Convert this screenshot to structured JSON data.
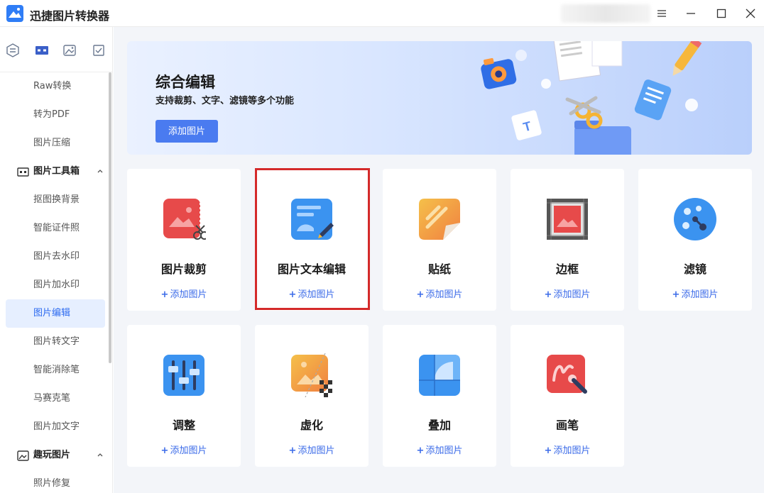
{
  "app": {
    "title": "迅捷图片转换器"
  },
  "sidebar": {
    "items": [
      {
        "label": "Raw转换",
        "type": "item"
      },
      {
        "label": "转为PDF",
        "type": "item"
      },
      {
        "label": "图片压缩",
        "type": "item"
      },
      {
        "label": "图片工具箱",
        "type": "group"
      },
      {
        "label": "抠图换背景",
        "type": "item"
      },
      {
        "label": "智能证件照",
        "type": "item"
      },
      {
        "label": "图片去水印",
        "type": "item"
      },
      {
        "label": "图片加水印",
        "type": "item"
      },
      {
        "label": "图片编辑",
        "type": "item",
        "active": true
      },
      {
        "label": "图片转文字",
        "type": "item"
      },
      {
        "label": "智能消除笔",
        "type": "item"
      },
      {
        "label": "马赛克笔",
        "type": "item"
      },
      {
        "label": "图片加文字",
        "type": "item"
      },
      {
        "label": "趣玩图片",
        "type": "group"
      },
      {
        "label": "照片修复",
        "type": "item"
      }
    ]
  },
  "banner": {
    "title": "综合编辑",
    "subtitle": "支持裁剪、文字、滤镜等多个功能",
    "button": "添加图片"
  },
  "cards": [
    {
      "name": "图片裁剪",
      "add": "添加图片",
      "icon": "crop-icon"
    },
    {
      "name": "图片文本编辑",
      "add": "添加图片",
      "icon": "text-edit-icon"
    },
    {
      "name": "贴纸",
      "add": "添加图片",
      "icon": "sticker-icon"
    },
    {
      "name": "边框",
      "add": "添加图片",
      "icon": "frame-icon"
    },
    {
      "name": "滤镜",
      "add": "添加图片",
      "icon": "filter-icon"
    },
    {
      "name": "调整",
      "add": "添加图片",
      "icon": "adjust-icon"
    },
    {
      "name": "虚化",
      "add": "添加图片",
      "icon": "blur-icon"
    },
    {
      "name": "叠加",
      "add": "添加图片",
      "icon": "overlay-icon"
    },
    {
      "name": "画笔",
      "add": "添加图片",
      "icon": "brush-icon"
    }
  ],
  "colors": {
    "accent": "#4a7bf0",
    "link": "#3a6ae8",
    "active_bg": "#e6efff",
    "highlight": "#d42a2a"
  }
}
